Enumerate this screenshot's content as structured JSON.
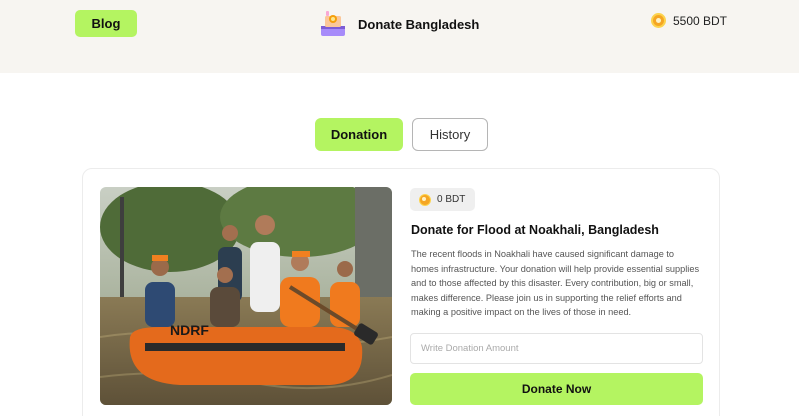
{
  "header": {
    "blog_label": "Blog",
    "brand_title": "Donate Bangladesh",
    "brand_logo_icon": "donation-box-icon",
    "balance_icon": "coin-icon",
    "balance": "5500 BDT"
  },
  "tabs": [
    {
      "label": "Donation",
      "active": true
    },
    {
      "label": "History",
      "active": false
    }
  ],
  "card": {
    "image_icon": "flood-rescue-photo",
    "amount_icon": "coin-icon",
    "amount": "0 BDT",
    "title": "Donate for Flood at Noakhali, Bangladesh",
    "description": " The recent floods in Noakhali have caused significant damage to homes  infrastructure. Your donation will help provide essential supplies and  to those affected by this disaster. Every contribution, big or small, makes  difference. Please join us in supporting the relief efforts and making a positive impact on the lives of those in need.",
    "input_placeholder": "Write Donation Amount",
    "input_value": "",
    "button_label": "Donate Now"
  },
  "colors": {
    "accent": "#b4f461",
    "header_bg": "#f7f5f1",
    "coin": "#f5a623"
  }
}
